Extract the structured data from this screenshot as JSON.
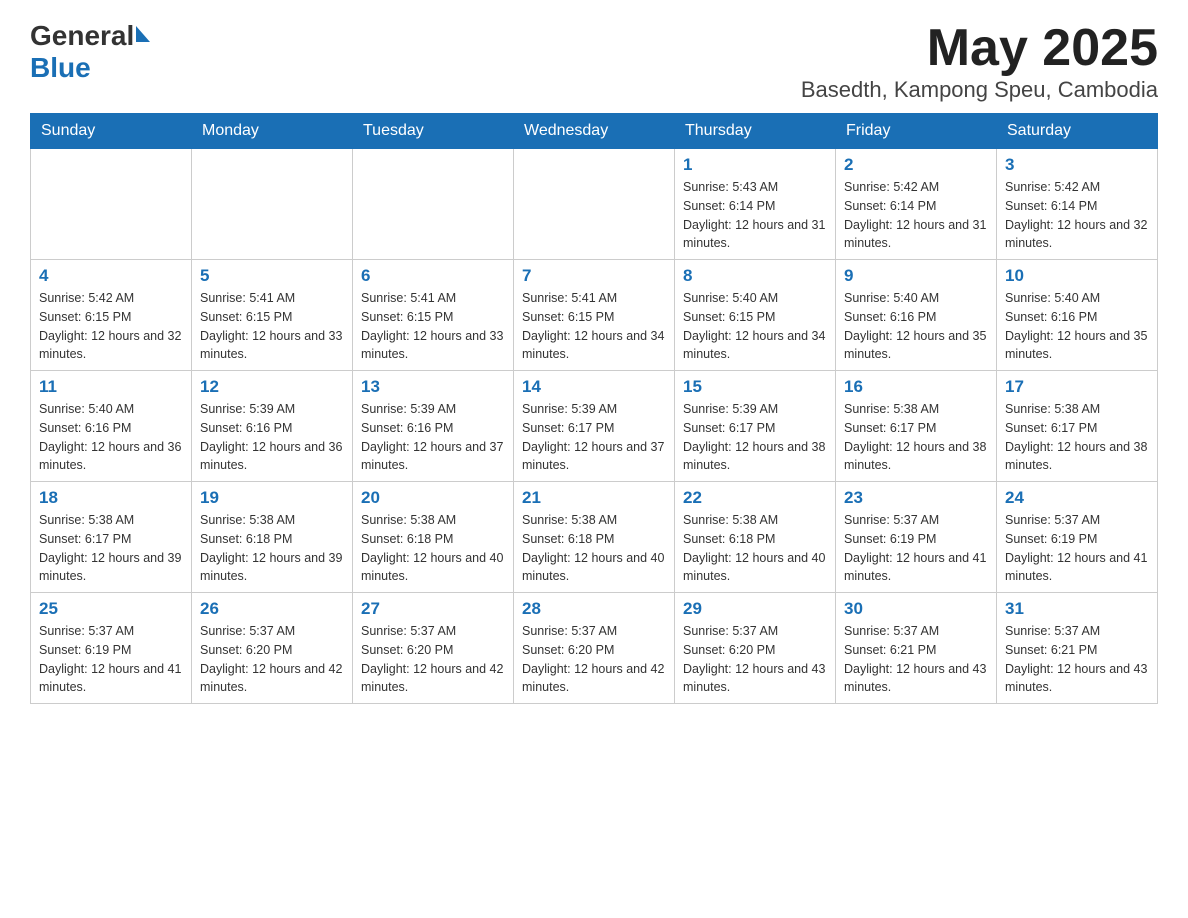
{
  "header": {
    "logo": {
      "general": "General",
      "triangle": "",
      "blue": "Blue"
    },
    "month": "May 2025",
    "location": "Basedth, Kampong Speu, Cambodia"
  },
  "weekdays": [
    "Sunday",
    "Monday",
    "Tuesday",
    "Wednesday",
    "Thursday",
    "Friday",
    "Saturday"
  ],
  "weeks": [
    [
      {
        "day": "",
        "info": ""
      },
      {
        "day": "",
        "info": ""
      },
      {
        "day": "",
        "info": ""
      },
      {
        "day": "",
        "info": ""
      },
      {
        "day": "1",
        "info": "Sunrise: 5:43 AM\nSunset: 6:14 PM\nDaylight: 12 hours and 31 minutes."
      },
      {
        "day": "2",
        "info": "Sunrise: 5:42 AM\nSunset: 6:14 PM\nDaylight: 12 hours and 31 minutes."
      },
      {
        "day": "3",
        "info": "Sunrise: 5:42 AM\nSunset: 6:14 PM\nDaylight: 12 hours and 32 minutes."
      }
    ],
    [
      {
        "day": "4",
        "info": "Sunrise: 5:42 AM\nSunset: 6:15 PM\nDaylight: 12 hours and 32 minutes."
      },
      {
        "day": "5",
        "info": "Sunrise: 5:41 AM\nSunset: 6:15 PM\nDaylight: 12 hours and 33 minutes."
      },
      {
        "day": "6",
        "info": "Sunrise: 5:41 AM\nSunset: 6:15 PM\nDaylight: 12 hours and 33 minutes."
      },
      {
        "day": "7",
        "info": "Sunrise: 5:41 AM\nSunset: 6:15 PM\nDaylight: 12 hours and 34 minutes."
      },
      {
        "day": "8",
        "info": "Sunrise: 5:40 AM\nSunset: 6:15 PM\nDaylight: 12 hours and 34 minutes."
      },
      {
        "day": "9",
        "info": "Sunrise: 5:40 AM\nSunset: 6:16 PM\nDaylight: 12 hours and 35 minutes."
      },
      {
        "day": "10",
        "info": "Sunrise: 5:40 AM\nSunset: 6:16 PM\nDaylight: 12 hours and 35 minutes."
      }
    ],
    [
      {
        "day": "11",
        "info": "Sunrise: 5:40 AM\nSunset: 6:16 PM\nDaylight: 12 hours and 36 minutes."
      },
      {
        "day": "12",
        "info": "Sunrise: 5:39 AM\nSunset: 6:16 PM\nDaylight: 12 hours and 36 minutes."
      },
      {
        "day": "13",
        "info": "Sunrise: 5:39 AM\nSunset: 6:16 PM\nDaylight: 12 hours and 37 minutes."
      },
      {
        "day": "14",
        "info": "Sunrise: 5:39 AM\nSunset: 6:17 PM\nDaylight: 12 hours and 37 minutes."
      },
      {
        "day": "15",
        "info": "Sunrise: 5:39 AM\nSunset: 6:17 PM\nDaylight: 12 hours and 38 minutes."
      },
      {
        "day": "16",
        "info": "Sunrise: 5:38 AM\nSunset: 6:17 PM\nDaylight: 12 hours and 38 minutes."
      },
      {
        "day": "17",
        "info": "Sunrise: 5:38 AM\nSunset: 6:17 PM\nDaylight: 12 hours and 38 minutes."
      }
    ],
    [
      {
        "day": "18",
        "info": "Sunrise: 5:38 AM\nSunset: 6:17 PM\nDaylight: 12 hours and 39 minutes."
      },
      {
        "day": "19",
        "info": "Sunrise: 5:38 AM\nSunset: 6:18 PM\nDaylight: 12 hours and 39 minutes."
      },
      {
        "day": "20",
        "info": "Sunrise: 5:38 AM\nSunset: 6:18 PM\nDaylight: 12 hours and 40 minutes."
      },
      {
        "day": "21",
        "info": "Sunrise: 5:38 AM\nSunset: 6:18 PM\nDaylight: 12 hours and 40 minutes."
      },
      {
        "day": "22",
        "info": "Sunrise: 5:38 AM\nSunset: 6:18 PM\nDaylight: 12 hours and 40 minutes."
      },
      {
        "day": "23",
        "info": "Sunrise: 5:37 AM\nSunset: 6:19 PM\nDaylight: 12 hours and 41 minutes."
      },
      {
        "day": "24",
        "info": "Sunrise: 5:37 AM\nSunset: 6:19 PM\nDaylight: 12 hours and 41 minutes."
      }
    ],
    [
      {
        "day": "25",
        "info": "Sunrise: 5:37 AM\nSunset: 6:19 PM\nDaylight: 12 hours and 41 minutes."
      },
      {
        "day": "26",
        "info": "Sunrise: 5:37 AM\nSunset: 6:20 PM\nDaylight: 12 hours and 42 minutes."
      },
      {
        "day": "27",
        "info": "Sunrise: 5:37 AM\nSunset: 6:20 PM\nDaylight: 12 hours and 42 minutes."
      },
      {
        "day": "28",
        "info": "Sunrise: 5:37 AM\nSunset: 6:20 PM\nDaylight: 12 hours and 42 minutes."
      },
      {
        "day": "29",
        "info": "Sunrise: 5:37 AM\nSunset: 6:20 PM\nDaylight: 12 hours and 43 minutes."
      },
      {
        "day": "30",
        "info": "Sunrise: 5:37 AM\nSunset: 6:21 PM\nDaylight: 12 hours and 43 minutes."
      },
      {
        "day": "31",
        "info": "Sunrise: 5:37 AM\nSunset: 6:21 PM\nDaylight: 12 hours and 43 minutes."
      }
    ]
  ]
}
